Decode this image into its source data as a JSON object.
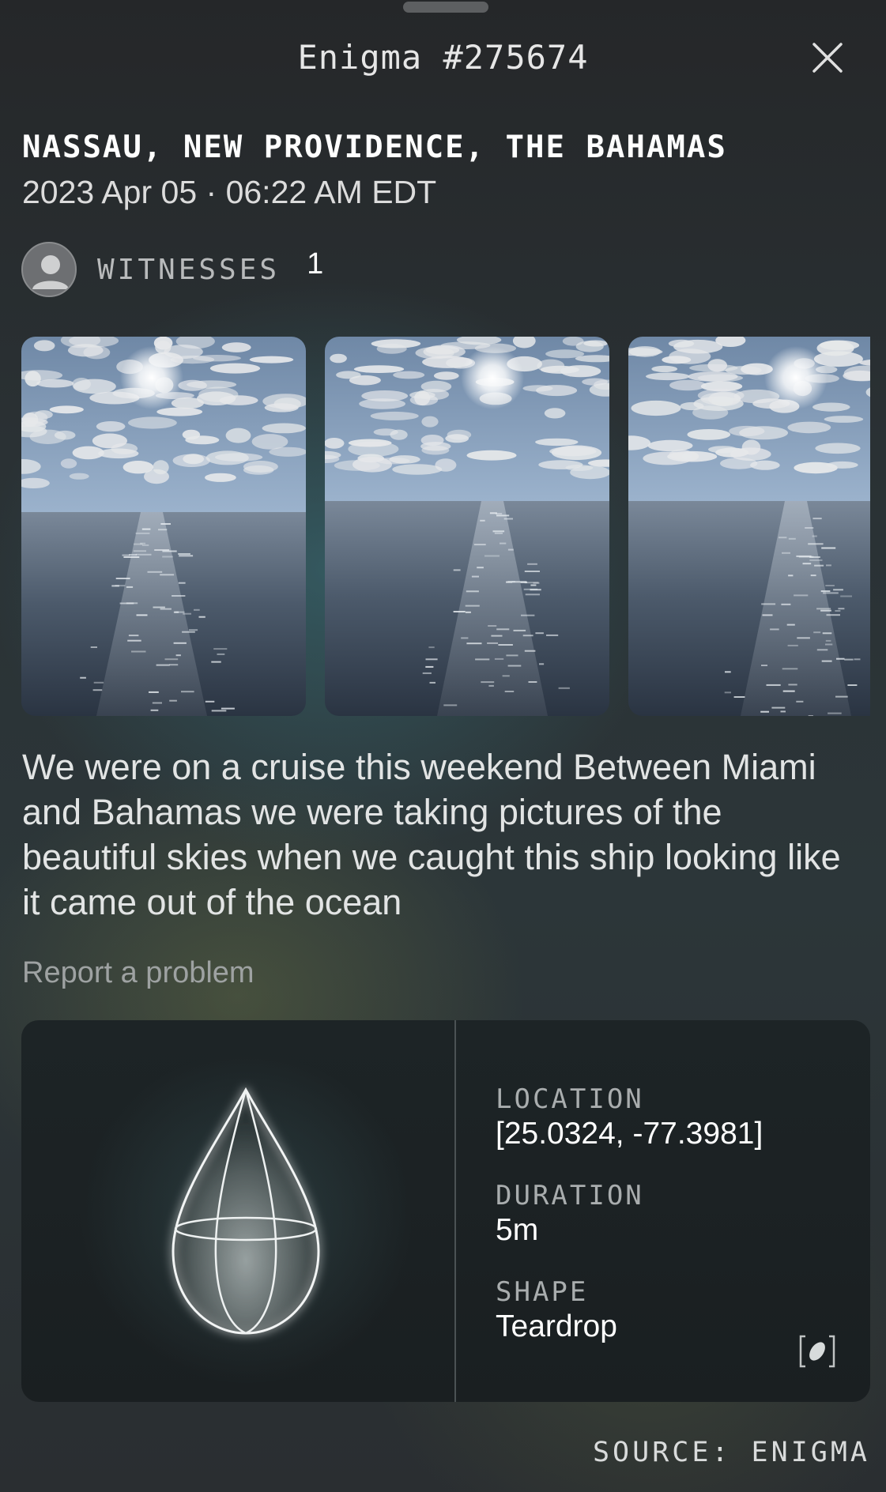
{
  "header": {
    "title": "Enigma #275674",
    "close_icon": "close-icon"
  },
  "sighting": {
    "location": "NASSAU, NEW PROVIDENCE, THE BAHAMAS",
    "datetime": "2023 Apr 05 · 06:22 AM EDT"
  },
  "witnesses": {
    "label": "WITNESSES",
    "count": "1",
    "avatar_icon": "person-avatar-icon"
  },
  "gallery": {
    "photos": [
      {
        "name": "photo-1"
      },
      {
        "name": "photo-2"
      },
      {
        "name": "photo-3"
      }
    ]
  },
  "description": "We were on a cruise this weekend Between Miami and Bahamas we were taking pictures of the beautiful skies when we caught this ship looking like it came out of the ocean",
  "report_link": "Report a problem",
  "details": {
    "shape_icon": "teardrop-wireframe-icon",
    "location_label": "LOCATION",
    "location_value": "[25.0324, -77.3981]",
    "duration_label": "DURATION",
    "duration_value": "5m",
    "shape_label": "SHAPE",
    "shape_value": "Teardrop",
    "expand_icon": "shape-detail-icon"
  },
  "footer": {
    "source": "SOURCE: ENIGMA"
  },
  "colors": {
    "background": "#2a3134",
    "card": "#1b2123",
    "muted_text": "#a9adae"
  }
}
